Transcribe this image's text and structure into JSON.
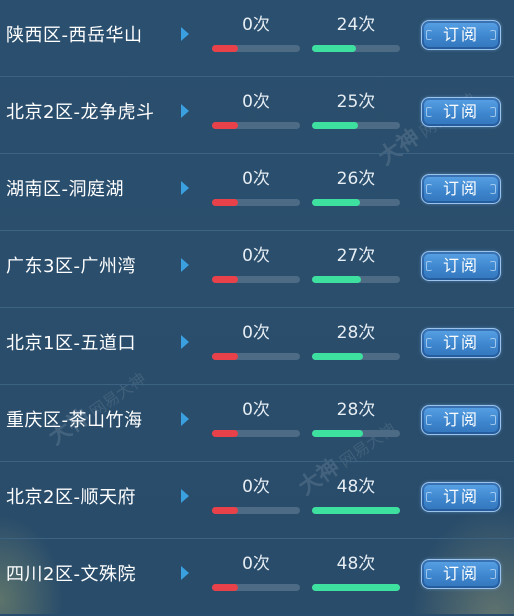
{
  "subscribe_label": "订阅",
  "watermark": {
    "mark": "大神",
    "text": "网易大神"
  },
  "colors": {
    "background": "#294d6c",
    "left_bar": "#e8414a",
    "right_bar": "#3ee0a0",
    "button": "#3c84cc",
    "arrow": "#3aa0e0"
  },
  "servers": [
    {
      "name": "陕西区-西岳华山",
      "left_count": "0次",
      "right_count": "24次",
      "left_progress": 0.3,
      "right_progress": 0.5
    },
    {
      "name": "北京2区-龙争虎斗",
      "left_count": "0次",
      "right_count": "25次",
      "left_progress": 0.3,
      "right_progress": 0.52
    },
    {
      "name": "湖南区-洞庭湖",
      "left_count": "0次",
      "right_count": "26次",
      "left_progress": 0.3,
      "right_progress": 0.54
    },
    {
      "name": "广东3区-广州湾",
      "left_count": "0次",
      "right_count": "27次",
      "left_progress": 0.3,
      "right_progress": 0.56
    },
    {
      "name": "北京1区-五道口",
      "left_count": "0次",
      "right_count": "28次",
      "left_progress": 0.3,
      "right_progress": 0.58
    },
    {
      "name": "重庆区-茶山竹海",
      "left_count": "0次",
      "right_count": "28次",
      "left_progress": 0.3,
      "right_progress": 0.58
    },
    {
      "name": "北京2区-顺天府",
      "left_count": "0次",
      "right_count": "48次",
      "left_progress": 0.3,
      "right_progress": 1.0
    },
    {
      "name": "四川2区-文殊院",
      "left_count": "0次",
      "right_count": "48次",
      "left_progress": 0.3,
      "right_progress": 1.0
    }
  ]
}
